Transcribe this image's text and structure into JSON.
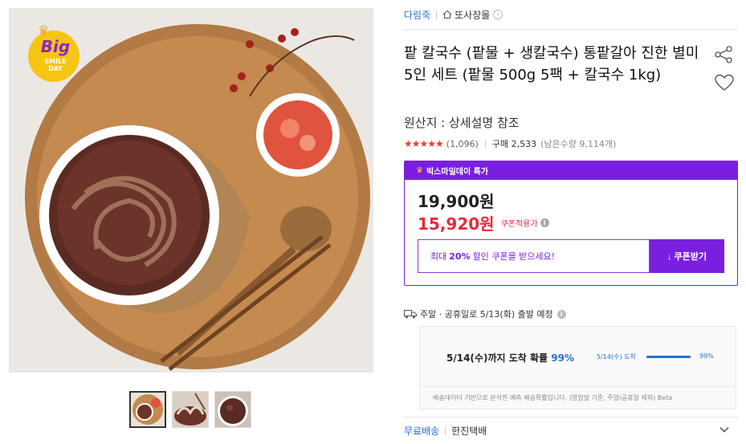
{
  "badge": {
    "line1": "Big",
    "line2": "SMILE",
    "line3": "DAY"
  },
  "thumbnails": [
    {
      "name": "thumb-1"
    },
    {
      "name": "thumb-2"
    },
    {
      "name": "thumb-3"
    }
  ],
  "breadcrumb": {
    "seller": "다림죽",
    "store": "또사장몰",
    "store_arrow": "›"
  },
  "product": {
    "title": "팥 칼국수 (팥물 + 생칼국수) 통팥갈아 진한 별미 5인 세트 (팥물 500g 5팩 + 칼국수 1kg)",
    "origin": "원산지 : 상세설명 참조",
    "stars": "★★★★★",
    "rating_value": 4.5,
    "review_count": "(1,096)",
    "purchase_count": "구매 2,533",
    "remaining": "(남은수량 9,114개)"
  },
  "price_box": {
    "header": "빅스마일데이 특가",
    "original_price": "19,900원",
    "sale_price": "15,920원",
    "coupon_applied": "쿠폰적용가",
    "coupon_message_prefix": "최대",
    "coupon_message_pct": "20%",
    "coupon_message_suffix": "할인 쿠폰을 받으세요!",
    "coupon_button": "↓ 쿠폰받기",
    "accent_color": "#7a1fe0",
    "sale_color": "#e8293b"
  },
  "shipping": {
    "schedule": "주말 · 공휴일로 5/13(화) 출발 예정",
    "forecast_main": "5/14(수)까지 도착 확률",
    "forecast_pct": "99%",
    "forecast_date": "5/14(수) 도착",
    "forecast_bar_value": 0.99,
    "forecast_bar_pct": "99%",
    "forecast_note": "배송데이터 기반으로 분석한 예측 배송확률입니다. (영업일 기준, 주말/공휴일 제외) Beta",
    "free_shipping": "무료배송",
    "courier": "한진택배"
  },
  "info_glyph": "i"
}
